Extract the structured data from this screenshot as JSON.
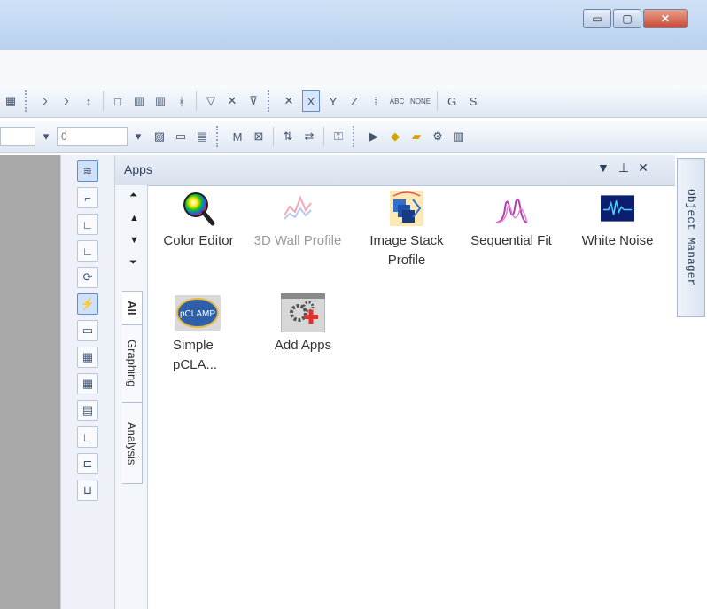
{
  "window": {
    "minimize_symbol": "▭",
    "maximize_symbol": "▢",
    "close_symbol": "✕"
  },
  "toolbar1": {
    "tools": [
      "Σ",
      "Σ",
      "↕",
      "□",
      "▥",
      "▥",
      "ᚼ",
      "▽",
      "✕",
      "✕",
      "X",
      "Y",
      "Z",
      "⁞",
      "ABC",
      "NONE",
      "G",
      "S"
    ]
  },
  "toolbar2": {
    "combo1_value": "",
    "combo2_value": "0"
  },
  "panel": {
    "title": "Apps",
    "dropdown_symbol": "▼",
    "pin_symbol": "⊥",
    "close_symbol": "✕"
  },
  "tabs": {
    "all": "All",
    "graphing": "Graphing",
    "analysis": "Analysis"
  },
  "object_manager": "Object Manager",
  "apps": [
    {
      "label": "Color Editor",
      "enabled": true,
      "icon": "color-editor-icon"
    },
    {
      "label": "3D Wall Profile",
      "enabled": false,
      "icon": "3d-wall-profile-icon"
    },
    {
      "label": "Image Stack Profile",
      "enabled": true,
      "icon": "image-stack-profile-icon"
    },
    {
      "label": "Sequential Fit",
      "enabled": true,
      "icon": "sequential-fit-icon"
    },
    {
      "label": "White Noise",
      "enabled": true,
      "icon": "white-noise-icon"
    },
    {
      "label": "Simple pCLA...",
      "enabled": true,
      "icon": "pclamp-icon"
    },
    {
      "label": "Add Apps",
      "enabled": true,
      "icon": "add-apps-icon"
    }
  ],
  "colors": {
    "titlebar": "#c4d9f2",
    "close_button": "#c74a33",
    "accent": "#5d8ed1"
  }
}
